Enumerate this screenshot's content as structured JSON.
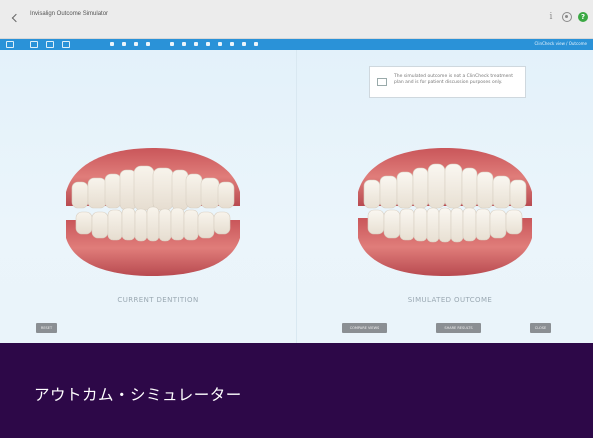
{
  "window": {
    "title": "Invisalign Outcome Simulator"
  },
  "toolbar": {
    "status_text": "ClinCheck view / Outcome"
  },
  "viewport": {
    "left_caption": "CURRENT DENTITION",
    "right_caption": "SIMULATED OUTCOME",
    "left_button": "RESET",
    "right_buttons": [
      "COMPARE VIEWS",
      "SHARE RESULTS",
      "CLOSE"
    ],
    "tooltip": "The simulated outcome is not a ClinCheck treatment plan and is for patient discussion purposes only."
  },
  "banner": {
    "text": "アウトカム・シミュレーター"
  },
  "colors": {
    "toolbar": "#2a92d8",
    "viewport_bg": "#e3f1fa",
    "banner_bg": "#2d0848",
    "help_icon": "#3aa843",
    "gum": "#d96b6b",
    "tooth": "#f4efe6"
  }
}
